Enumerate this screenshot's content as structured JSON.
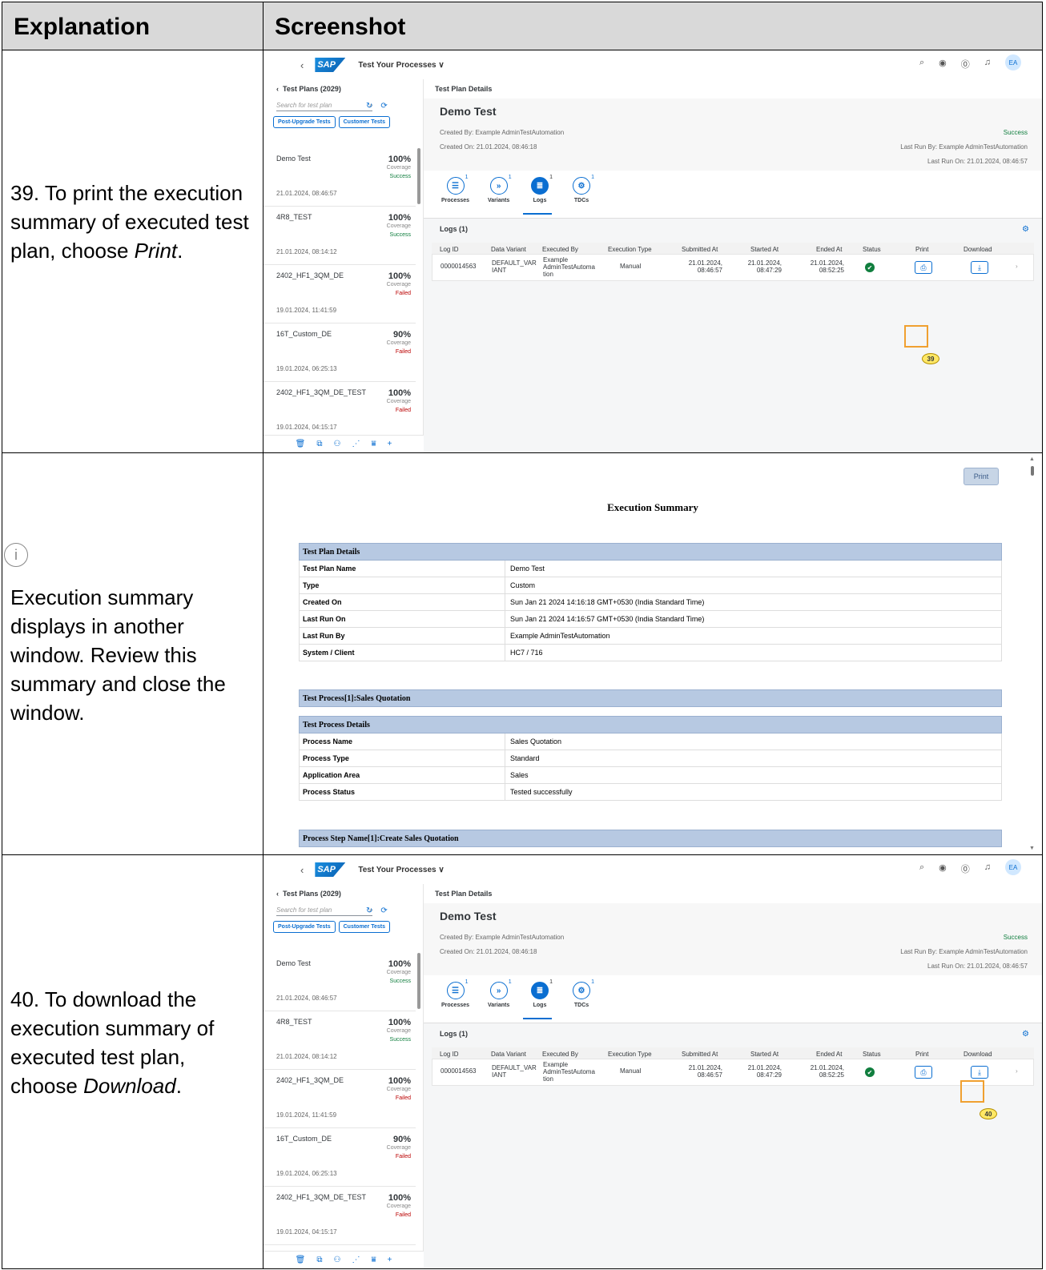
{
  "table_header": {
    "col1": "Explanation",
    "col2": "Screenshot"
  },
  "rows": [
    {
      "text": "39. To print the execution summary of executed test plan, choose ",
      "emphasis": "Print",
      "suffix": "."
    },
    {
      "info_icon": "info-icon",
      "text": "Execution summary displays in another window. Review this summary and close the window."
    },
    {
      "text": "40. To download the execution summary of executed test plan, choose ",
      "emphasis": "Download",
      "suffix": "."
    }
  ],
  "app": {
    "logo": "SAP",
    "title": "Test Your Processes ∨",
    "avatar": "EA",
    "left_title": "Test Plans (2029)",
    "search_placeholder": "Search for test plan",
    "tab1": "Post-Upgrade Tests",
    "tab2": "Customer Tests",
    "plans": [
      {
        "name": "Demo Test",
        "pct": "100%",
        "cov": "Coverage",
        "status": "Success",
        "date": "21.01.2024, 08:46:57"
      },
      {
        "name": "4R8_TEST",
        "pct": "100%",
        "cov": "Coverage",
        "status": "Success",
        "date": "21.01.2024, 08:14:12"
      },
      {
        "name": "2402_HF1_3QM_DE",
        "pct": "100%",
        "cov": "Coverage",
        "status": "Failed",
        "date": "19.01.2024, 11:41:59"
      },
      {
        "name": "16T_Custom_DE",
        "pct": "90%",
        "cov": "Coverage",
        "status": "Failed",
        "date": "19.01.2024, 06:25:13"
      },
      {
        "name": "2402_HF1_3QM_DE_TEST",
        "pct": "100%",
        "cov": "Coverage",
        "status": "Failed",
        "date": "19.01.2024, 04:15:17"
      }
    ],
    "details_title": "Test Plan Details",
    "plan_title": "Demo Test",
    "created_by": "Created By: Example AdminTestAutomation",
    "created_on": "Created On: 21.01.2024, 08:46:18",
    "result": "Success",
    "last_run_by": "Last Run By: Example AdminTestAutomation",
    "last_run_on": "Last Run On: 21.01.2024, 08:46:57",
    "anchors": [
      "Processes",
      "Variants",
      "Logs",
      "TDCs"
    ],
    "anchor_counts": [
      "1",
      "1",
      "1",
      "1"
    ],
    "logs_title": "Logs (1)",
    "cols": [
      "Log ID",
      "Data Variant",
      "Executed By",
      "Execution Type",
      "Submitted At",
      "Started At",
      "Ended At",
      "Status",
      "Print",
      "Download"
    ],
    "log": {
      "id": "0000014563",
      "variant": "DEFAULT_VAR IANT",
      "by": "Example AdminTestAutoma tion",
      "type": "Manual",
      "submitted": "21.01.2024, 08:46:57",
      "started": "21.01.2024, 08:47:29",
      "ended": "21.01.2024, 08:52:25"
    }
  },
  "callouts": [
    "39",
    "40"
  ],
  "summary": {
    "print_label": "Print",
    "title": "Execution Summary",
    "sec1": "Test Plan Details",
    "details": [
      {
        "k": "Test Plan Name",
        "v": "Demo Test"
      },
      {
        "k": "Type",
        "v": "Custom"
      },
      {
        "k": "Created On",
        "v": "Sun Jan 21 2024 14:16:18 GMT+0530 (India Standard Time)"
      },
      {
        "k": "Last Run On",
        "v": "Sun Jan 21 2024 14:16:57 GMT+0530 (India Standard Time)"
      },
      {
        "k": "Last Run By",
        "v": "Example AdminTestAutomation"
      },
      {
        "k": "System / Client",
        "v": "HC7 / 716"
      }
    ],
    "sec2": "Test Process[1]:Sales Quotation",
    "sec3": "Test Process Details",
    "process": [
      {
        "k": "Process Name",
        "v": "Sales Quotation"
      },
      {
        "k": "Process Type",
        "v": "Standard"
      },
      {
        "k": "Application Area",
        "v": "Sales"
      },
      {
        "k": "Process Status",
        "v": "Tested successfully"
      }
    ],
    "sec4": "Process Step Name[1]:Create Sales Quotation"
  }
}
